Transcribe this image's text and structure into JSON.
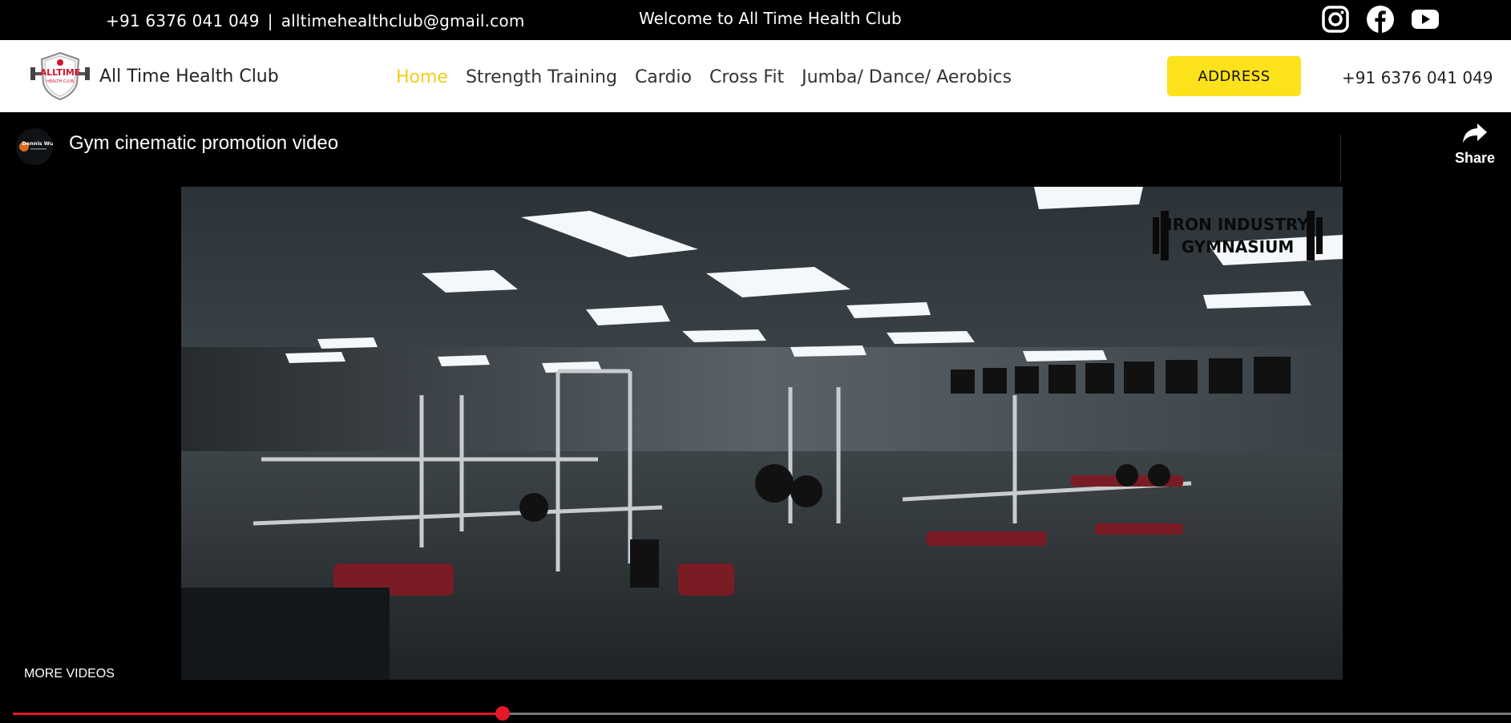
{
  "topbar": {
    "phone": "+91 6376 041 049",
    "separator": "|",
    "email": "alltimehealthclub@gmail.com",
    "welcome": "Welcome to All Time Health Club",
    "social_icons": [
      "instagram-icon",
      "facebook-icon",
      "youtube-icon"
    ]
  },
  "nav": {
    "logo_text": "ALLTIME",
    "logo_subtext": "HEALTH CLUB",
    "brand": "All Time Health Club",
    "items": [
      {
        "label": "Home",
        "active": true
      },
      {
        "label": "Strength Training",
        "active": false
      },
      {
        "label": "Cardio",
        "active": false
      },
      {
        "label": "Cross Fit",
        "active": false
      },
      {
        "label": "Jumba/ Dance/ Aerobics",
        "active": false
      }
    ],
    "address_button": "ADDRESS",
    "phone": "+91 6376 041 049"
  },
  "video": {
    "channel_name": "Dennis Wu",
    "title": "Gym cinematic promotion video",
    "share_label": "Share",
    "watermark_line1": "IRON INDUSTRY",
    "watermark_line2": "GYMNASIUM",
    "more_videos": "MORE VIDEOS",
    "progress_fraction": 0.327
  },
  "colors": {
    "accent_yellow": "#fce21a",
    "active_link": "#f2cc1c",
    "progress_red": "#e5172b"
  }
}
